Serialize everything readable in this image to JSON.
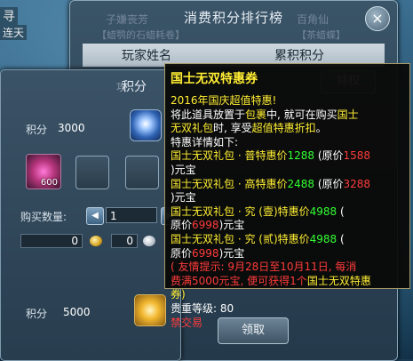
{
  "background": {
    "corner_text": [
      "寻",
      "连天"
    ]
  },
  "ranking_window": {
    "title": "消费积分排行榜",
    "columns": [
      "玩家姓名",
      "累积积分"
    ],
    "ghost_texts": [
      "子嫌丧芳",
      "百角仙",
      "【蜡鹗的石蜡耗卷】",
      "【茶蜡蝶】"
    ],
    "side_button_label": "特权",
    "close_symbol": "×"
  },
  "exchange_window": {
    "title": "积分",
    "score_label": "积分",
    "score_value": "3000",
    "item_count": "600",
    "qty_label": "购买数量:",
    "qty_value": "1",
    "gold_value": "0",
    "silver_value": "0",
    "bottom_score_label": "积分",
    "bottom_score_value": "5000",
    "claim_label": "领取",
    "partial_tab": "攻"
  },
  "tooltip": {
    "title": "国士无双特惠券",
    "lines": {
      "l1": "2016年国庆超值特惠!",
      "l2a": "将此道具放置于",
      "l2b": "包裹",
      "l2c": "中, 就可在购买",
      "l2d": "国士",
      "l3a": "无双礼包",
      "l3b": "时, 享受",
      "l3c": "超值特惠折扣",
      "l3d": "。",
      "l4": "特惠详情如下:",
      "l5a": "国士无双礼包 · 普特惠价",
      "l5b": "1288",
      "l5c": " (原价",
      "l5d": "1588",
      "l6": ")元宝",
      "l7a": "国士无双礼包 · 高特惠价",
      "l7b": "2488",
      "l7c": " (原价",
      "l7d": "3288",
      "l8": ")元宝",
      "l9a": "国士无双礼包 · 究 (壹)特惠价",
      "l9b": "4988",
      "l9c": " (",
      "l10a": "原价",
      "l10b": "6998",
      "l10c": ")元宝",
      "l11a": "国士无双礼包 · 究 (贰)特惠价",
      "l11b": "4988",
      "l11c": " (",
      "l12a": "原价",
      "l12b": "6998",
      "l12c": ")元宝",
      "l13": "( 友情提示: 9月28日至10月11日, 每消",
      "l14a": "费满5000元宝, 便可获得1个",
      "l14b": "国士无双特惠",
      "l15": "券)",
      "l16": "贵重等级: 80",
      "l17": "禁交易"
    }
  },
  "colors": {
    "yellow": "#ffee33",
    "green": "#33ff33",
    "red": "#ff3b3b"
  }
}
